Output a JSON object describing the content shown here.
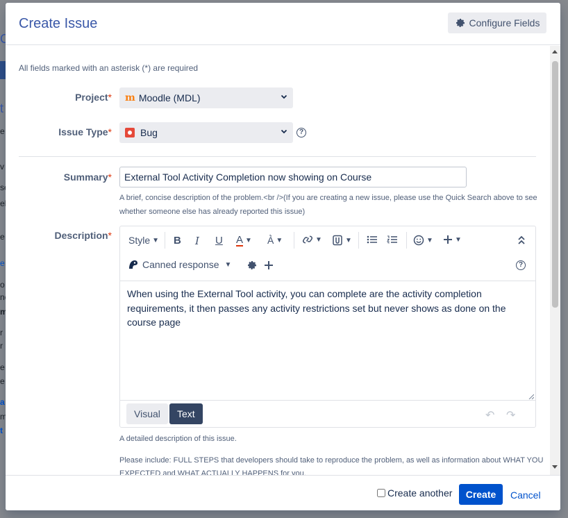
{
  "dialog": {
    "title": "Create Issue",
    "configure_fields_label": "Configure Fields"
  },
  "form": {
    "required_note": "All fields marked with an asterisk (*) are required",
    "project": {
      "label": "Project",
      "value": "Moodle (MDL)"
    },
    "issue_type": {
      "label": "Issue Type",
      "value": "Bug"
    },
    "summary": {
      "label": "Summary",
      "value": "External Tool Activity Completion now showing on Course",
      "hint_line1": "A brief, concise description of the problem.<br />(If you are creating a new issue, please use the Quick Search above to see",
      "hint_line2": "whether someone else has already reported this issue)"
    },
    "description": {
      "label": "Description",
      "toolbar": {
        "style_label": "Style",
        "bold": "B",
        "italic": "I",
        "underline": "U",
        "text_color": "A",
        "canned_response_label": "Canned response"
      },
      "value": "When using the External Tool activity, you can complete are the activity completion requirements, it then passes any activity restrictions set but never shows as done on the course page",
      "mode_visual": "Visual",
      "mode_text": "Text",
      "hint": "A detailed description of this issue.",
      "include_line1": "Please include: FULL STEPS that developers should take to reproduce the problem, as well as information about WHAT YOU",
      "include_line2": "EXPECTED and WHAT ACTUALLY HAPPENS for you."
    },
    "asterisk": "*"
  },
  "footer": {
    "create_another_label": "Create another",
    "create_label": "Create",
    "cancel_label": "Cancel"
  },
  "colors": {
    "title": "#3a58a8",
    "primary": "#0052cc",
    "required": "#de350b",
    "text_mode_active": "#344563"
  },
  "background_page": {
    "left_edge_fragments": [
      "C",
      "t",
      "e",
      "v",
      "se",
      "el",
      "e",
      "e",
      "o",
      "nc",
      "m",
      "r",
      "r",
      "e",
      "e",
      "a",
      "m",
      "t"
    ]
  }
}
